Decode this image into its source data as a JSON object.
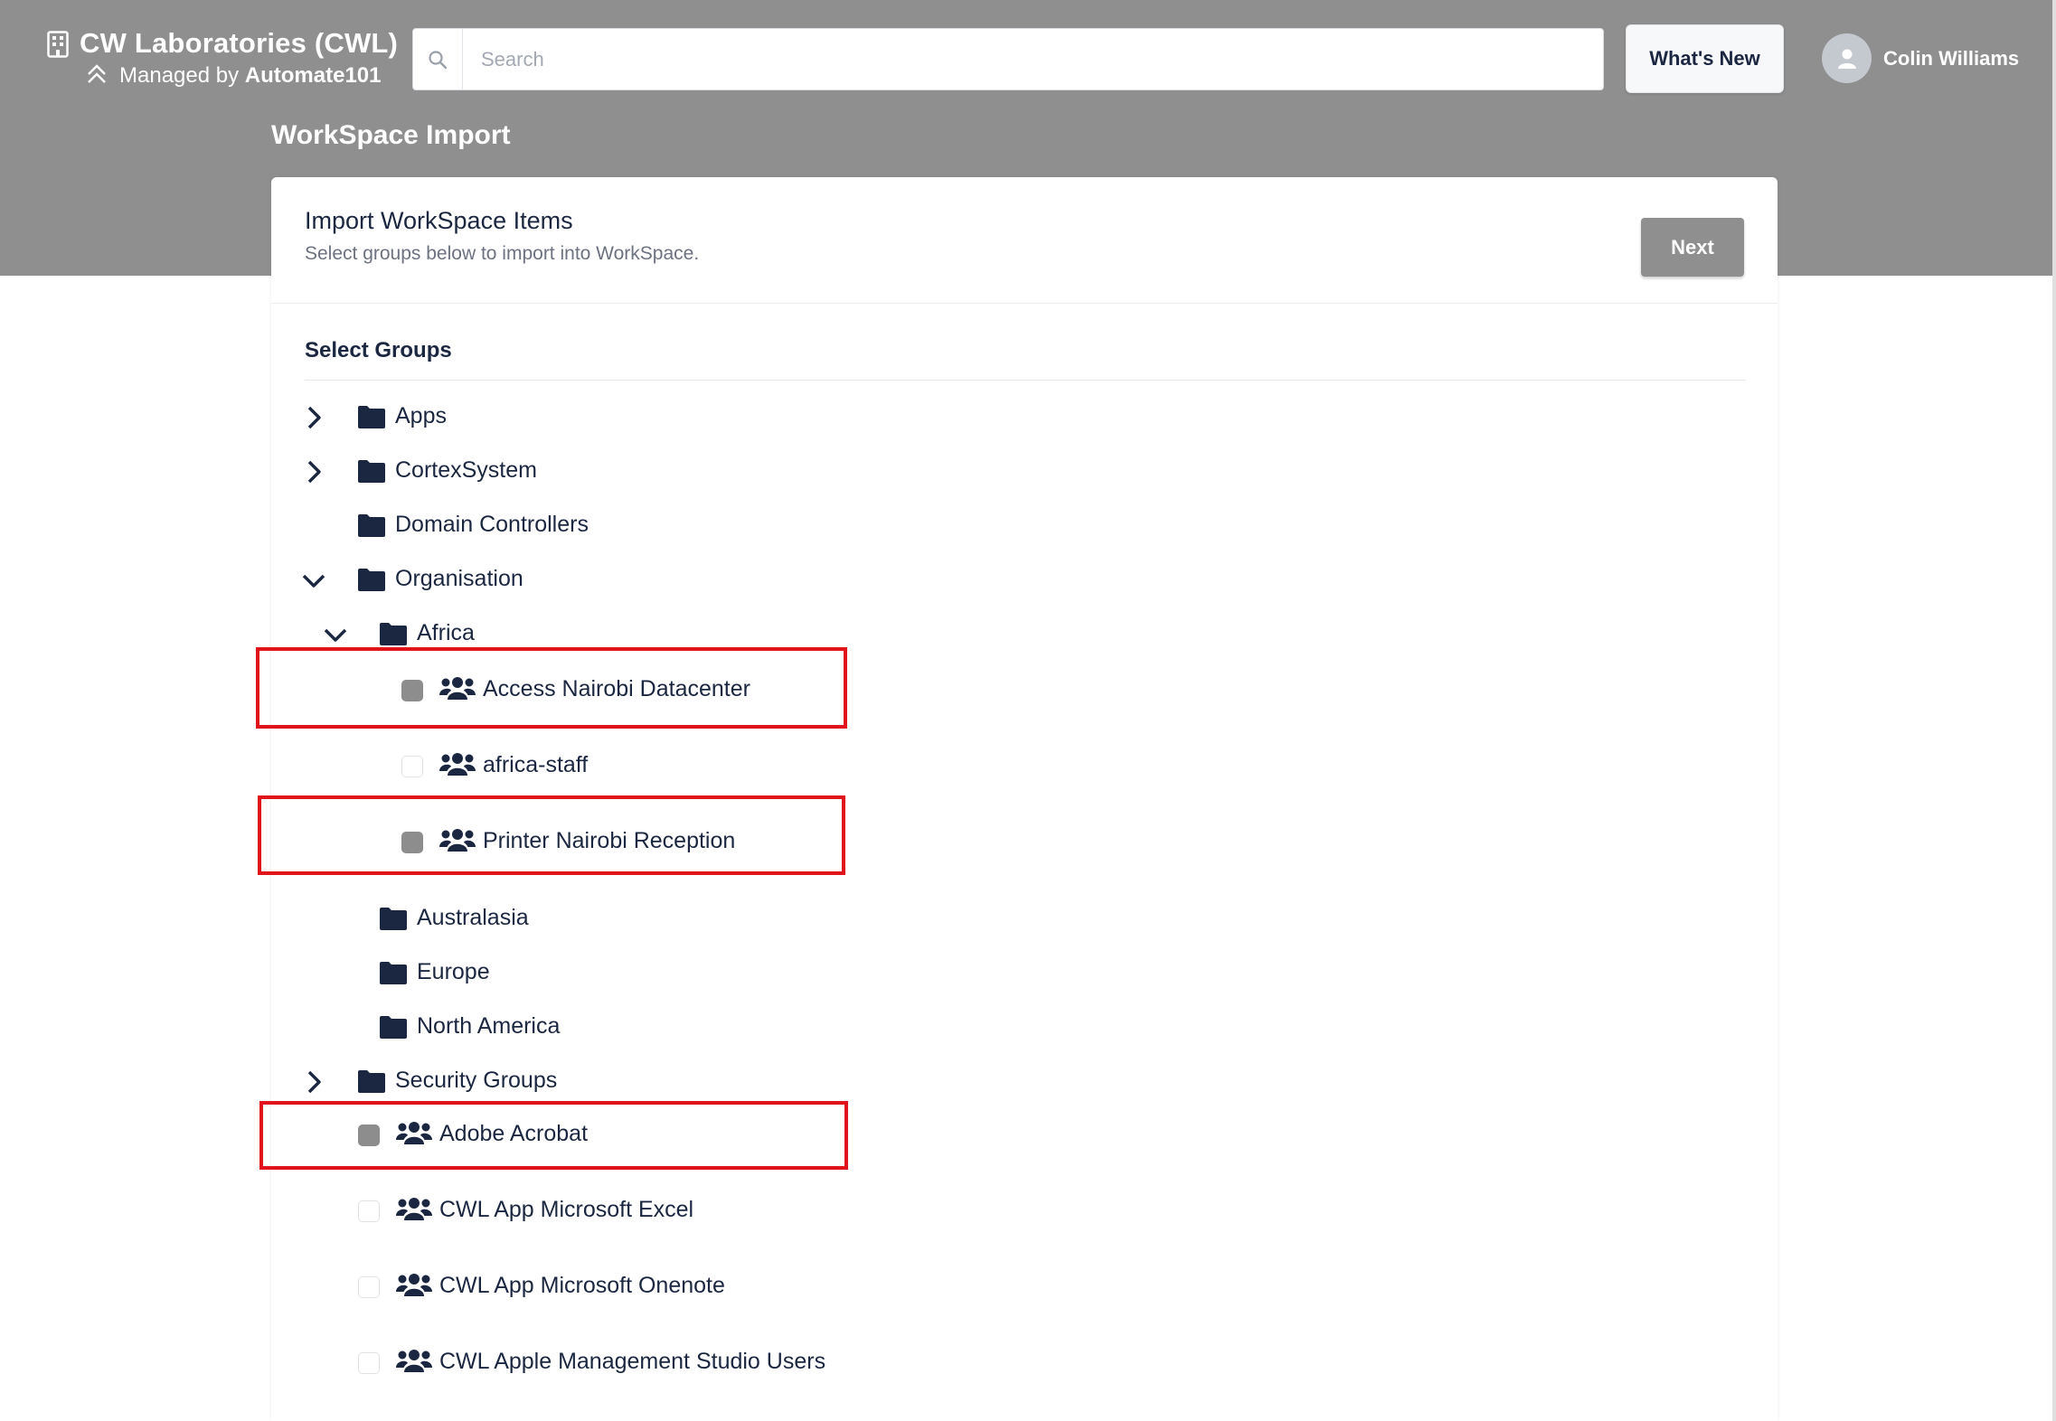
{
  "header": {
    "org_title": "CW Laboratories (CWL)",
    "managed_prefix": "Managed by ",
    "managed_by": "Automate101",
    "search_placeholder": "Search",
    "whats_new": "What's New",
    "user_name": "Colin Williams"
  },
  "page": {
    "title": "WorkSpace Import"
  },
  "card": {
    "title": "Import WorkSpace Items",
    "subtitle": "Select groups below to import into WorkSpace.",
    "next_label": "Next",
    "section_label": "Select Groups"
  },
  "tree": {
    "apps": "Apps",
    "cortex": "CortexSystem",
    "domain_controllers": "Domain Controllers",
    "organisation": "Organisation",
    "africa": "Africa",
    "access_nairobi": "Access Nairobi Datacenter",
    "africa_staff": "africa-staff",
    "printer_nairobi": "Printer Nairobi Reception",
    "australasia": "Australasia",
    "europe": "Europe",
    "north_america": "North America",
    "security_groups": "Security Groups",
    "adobe_acrobat": "Adobe Acrobat",
    "excel": "CWL App Microsoft Excel",
    "onenote": "CWL App Microsoft Onenote",
    "apple": "CWL Apple Management Studio Users"
  },
  "colors": {
    "header_band": "#8f8f8f",
    "text_dark": "#1b2741",
    "highlight": "#e1141b",
    "partial_checkbox": "#8d8d8d"
  }
}
